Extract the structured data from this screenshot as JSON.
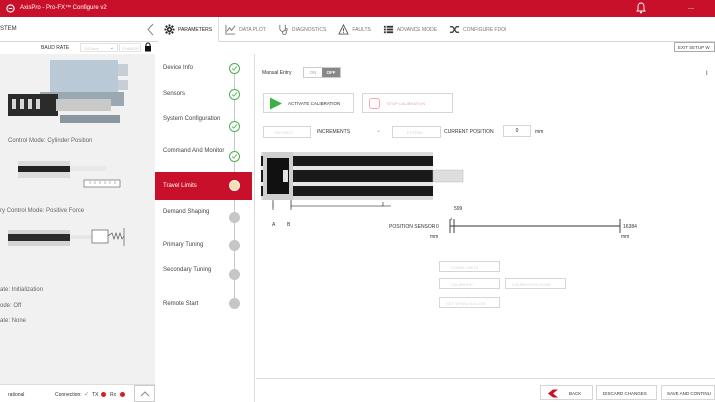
{
  "window": {
    "title": "AxisPro - Pro-FX™ Configure v2"
  },
  "nav": {
    "system_label": "STEM",
    "tabs": [
      {
        "label": "PARAMETERS",
        "icon": "gear-icon",
        "active": true
      },
      {
        "label": "DATA PLOT",
        "icon": "plot-icon"
      },
      {
        "label": "DIAGNOSTICS",
        "icon": "stethoscope-icon"
      },
      {
        "label": "FAULTS",
        "icon": "warning-icon"
      },
      {
        "label": "ADVANCE MODE",
        "icon": "list-icon"
      },
      {
        "label": "CONFIGURE FDOI",
        "icon": "shuffle-icon"
      }
    ]
  },
  "toolbar": {
    "baud_label": "BAUD RATE",
    "baud_value": "115 kb/s",
    "change_label": "CHANGE",
    "exit_label": "EXIT SETUP W"
  },
  "left": {
    "control_mode": "Control Mode: Cylinder Position",
    "secondary_mode": "ry Control Mode: Positive Force",
    "state": "ate: Initialization",
    "mode": "ode: Off",
    "fault": "ate: None",
    "status_prefix": "rational",
    "connection_label": "Connection:",
    "tx_label": "TX",
    "rx_label": "Rx"
  },
  "steps": [
    {
      "label": "Device Info",
      "state": "done"
    },
    {
      "label": "Sensors",
      "state": "done"
    },
    {
      "label": "System Configuration",
      "state": "done"
    },
    {
      "label": "Command And Monitor",
      "state": "done"
    },
    {
      "label": "Travel Limits",
      "state": "active"
    },
    {
      "label": "Demand Shaping",
      "state": "todo"
    },
    {
      "label": "Primary Tuning",
      "state": "todo"
    },
    {
      "label": "Secondary Tuning",
      "state": "todo"
    },
    {
      "label": "Remote Start",
      "state": "todo"
    }
  ],
  "travel": {
    "manual_entry_label": "Manual Entry",
    "toggle_on": "ON",
    "toggle_off": "OFF",
    "activate_label": "ACTIVATE CALIBRATION",
    "stop_label": "STOP CALIBRATION",
    "retract_label": "RETRACT",
    "increments_label": "INCREMENTS",
    "extend_label": "EXTEND",
    "current_position_label": "CURRENT POSITION",
    "current_position_value": "0",
    "unit_mm": "mm",
    "label_a": "A",
    "label_b": "B",
    "position_sensor_label": "POSITION SENSOR",
    "sensor_min": "0",
    "sensor_max": "16384",
    "sensor_marker": "599",
    "marker_tick": "1",
    "mm_left": "mm",
    "mm_right": "mm",
    "btn_learn": "LEARN LIMITS",
    "btn_calibrate": "CALIBRATE",
    "btn_calibrate_done": "CALIBRATION DONE",
    "btn_set": "SET SPEED & ACCEL",
    "right_letter": "I"
  },
  "footer": {
    "back_label": "BACK",
    "discard_label": "DISCARD CHANGES",
    "save_label": "SAVE AND CONTINU"
  },
  "colors": {
    "brand": "#c9102a",
    "success": "#4caf50",
    "pending": "#c6c6c6",
    "active_circle": "#f6e0b0",
    "play": "#3cb043",
    "tx_rx": "#d81e1e"
  }
}
